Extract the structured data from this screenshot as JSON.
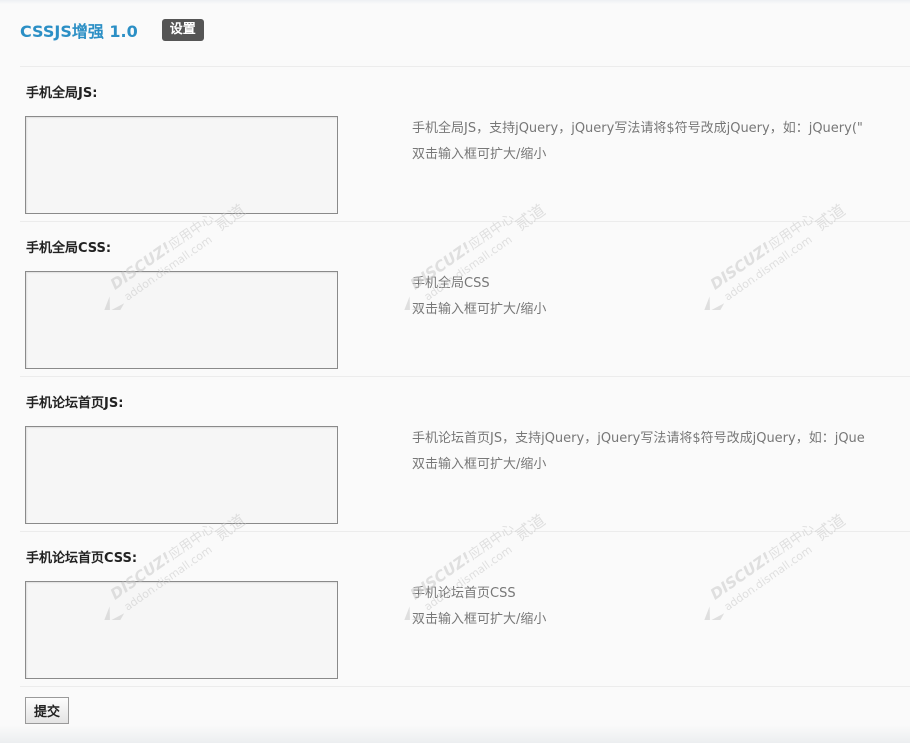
{
  "header": {
    "title": "CSSJS增强 1.0",
    "tab_settings": "设置"
  },
  "sections": [
    {
      "label": "手机全局JS:",
      "value": "",
      "desc_line1": "手机全局JS，支持jQuery，jQuery写法请将$符号改成jQuery，如：jQuery(\"",
      "desc_line2": "双击输入框可扩大/缩小"
    },
    {
      "label": "手机全局CSS:",
      "value": "",
      "desc_line1": "手机全局CSS",
      "desc_line2": "双击输入框可扩大/缩小"
    },
    {
      "label": "手机论坛首页JS:",
      "value": "",
      "desc_line1": "手机论坛首页JS，支持jQuery，jQuery写法请将$符号改成jQuery，如：jQue",
      "desc_line2": "双击输入框可扩大/缩小"
    },
    {
      "label": "手机论坛首页CSS:",
      "value": "",
      "desc_line1": "手机论坛首页CSS",
      "desc_line2": "双击输入框可扩大/缩小"
    }
  ],
  "submit_label": "提交",
  "watermark": {
    "brand": "DISCUZ!",
    "brand_cn": "应用中心",
    "url": "addon.dismall.com",
    "tag": "贰道"
  }
}
